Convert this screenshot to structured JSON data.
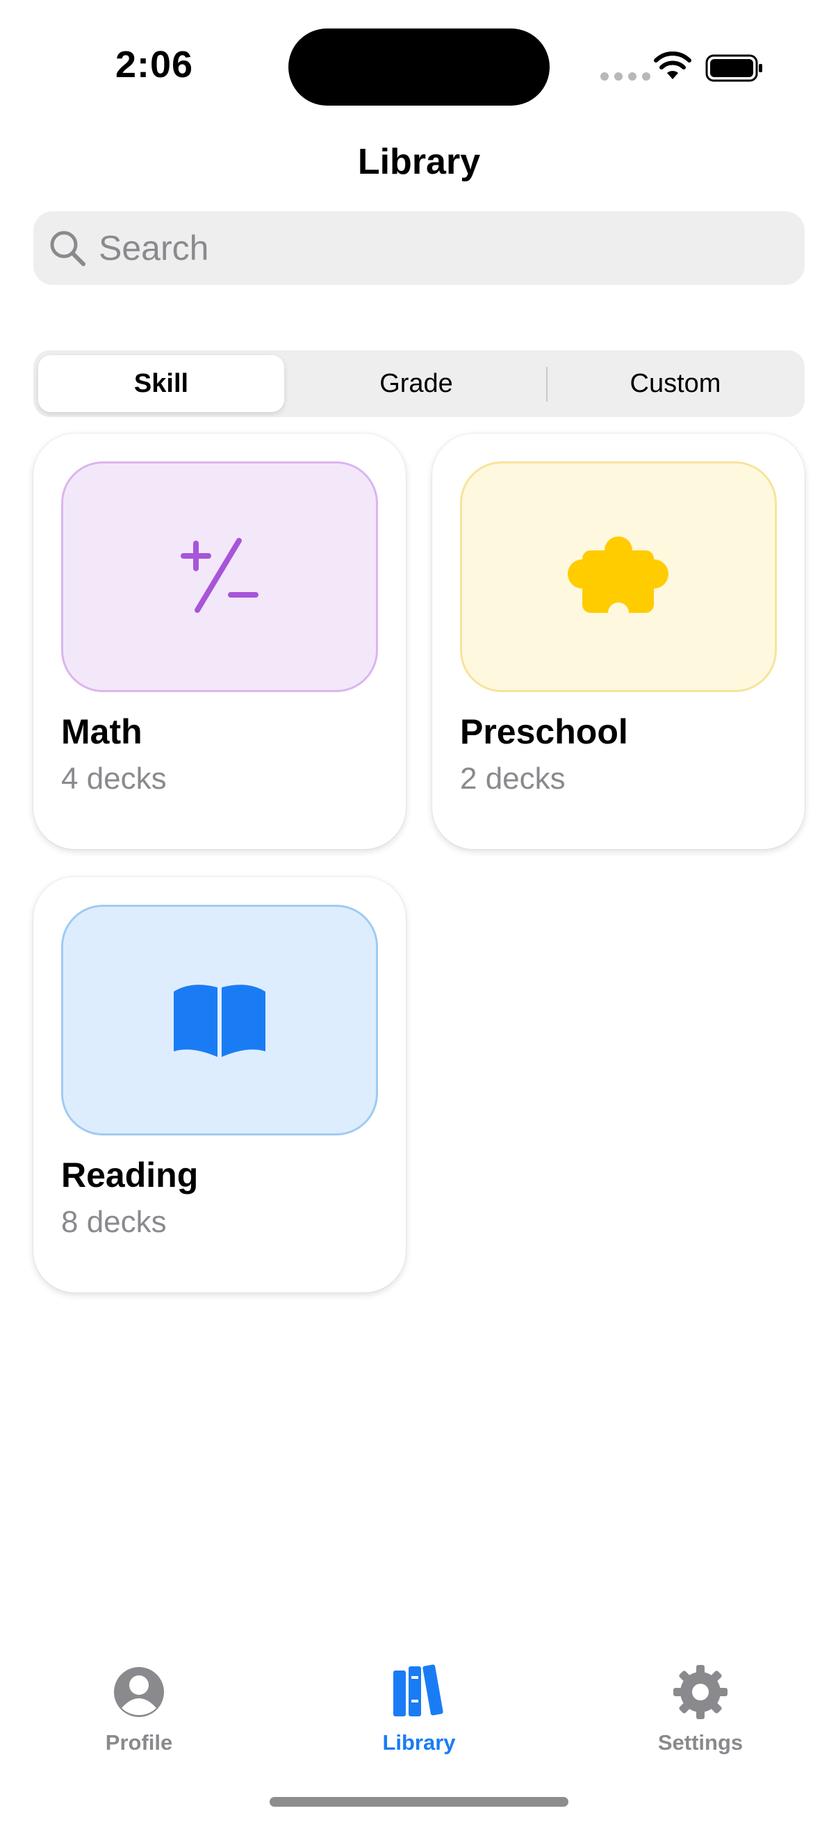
{
  "status_bar": {
    "time": "2:06"
  },
  "nav": {
    "title": "Library"
  },
  "search": {
    "placeholder": "Search"
  },
  "segments": [
    {
      "label": "Skill",
      "selected": true
    },
    {
      "label": "Grade",
      "selected": false
    },
    {
      "label": "Custom",
      "selected": false
    }
  ],
  "cards": [
    {
      "title": "Math",
      "subtitle": "4 decks",
      "icon": "plus-slash-minus-icon",
      "accent": "#a855d9",
      "tint": "#f3e8fa"
    },
    {
      "title": "Preschool",
      "subtitle": "2 decks",
      "icon": "puzzle-piece-icon",
      "accent": "#ffcc00",
      "tint": "#fef8df"
    },
    {
      "title": "Reading",
      "subtitle": "8 decks",
      "icon": "book-icon",
      "accent": "#1a7cf5",
      "tint": "#deedfd"
    }
  ],
  "tabs": [
    {
      "label": "Profile",
      "icon": "person-circle-icon",
      "active": false
    },
    {
      "label": "Library",
      "icon": "books-icon",
      "active": true
    },
    {
      "label": "Settings",
      "icon": "gear-icon",
      "active": false
    }
  ],
  "colors": {
    "accent": "#1a7cf5",
    "inactive": "#8a8a8e"
  }
}
